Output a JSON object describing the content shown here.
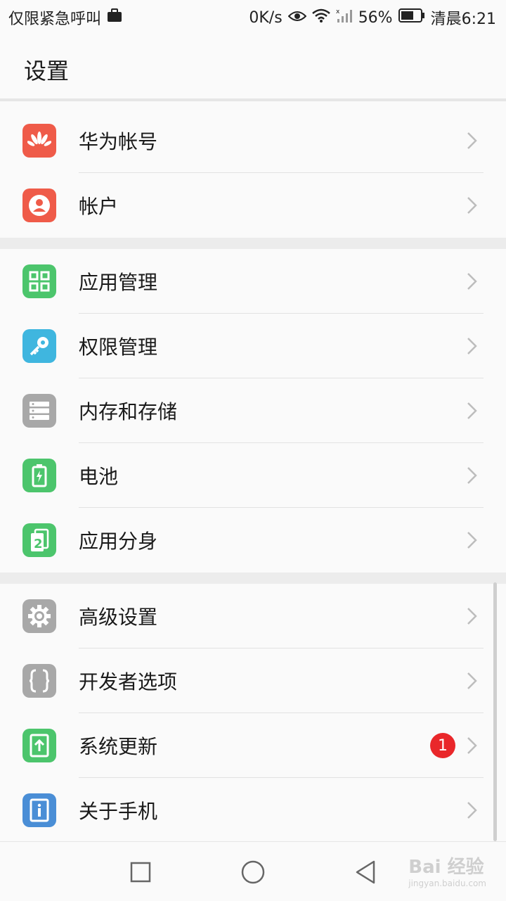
{
  "status_bar": {
    "left_text": "仅限紧急呼叫",
    "speed": "0K/s",
    "battery": "56%",
    "time": "清晨6:21"
  },
  "header": {
    "title": "设置"
  },
  "groups": [
    {
      "items": [
        {
          "label": "华为帐号",
          "icon": "huawei-logo-icon",
          "color": "#ef5b49"
        },
        {
          "label": "帐户",
          "icon": "account-icon",
          "color": "#ef5b49"
        }
      ]
    },
    {
      "items": [
        {
          "label": "应用管理",
          "icon": "apps-grid-icon",
          "color": "#4cc56c"
        },
        {
          "label": "权限管理",
          "icon": "key-icon",
          "color": "#3fb6df"
        },
        {
          "label": "内存和存储",
          "icon": "storage-icon",
          "color": "#a8a8a8"
        },
        {
          "label": "电池",
          "icon": "battery-icon",
          "color": "#4cc56c"
        },
        {
          "label": "应用分身",
          "icon": "app-twin-icon",
          "color": "#4cc56c"
        }
      ]
    },
    {
      "items": [
        {
          "label": "高级设置",
          "icon": "gear-icon",
          "color": "#a8a8a8"
        },
        {
          "label": "开发者选项",
          "icon": "braces-icon",
          "color": "#a8a8a8"
        },
        {
          "label": "系统更新",
          "icon": "update-icon",
          "color": "#4cc56c",
          "badge": "1"
        },
        {
          "label": "关于手机",
          "icon": "info-icon",
          "color": "#4a8ed6"
        }
      ]
    }
  ],
  "watermark": {
    "brand": "Bai 经验",
    "url": "jingyan.baidu.com"
  }
}
